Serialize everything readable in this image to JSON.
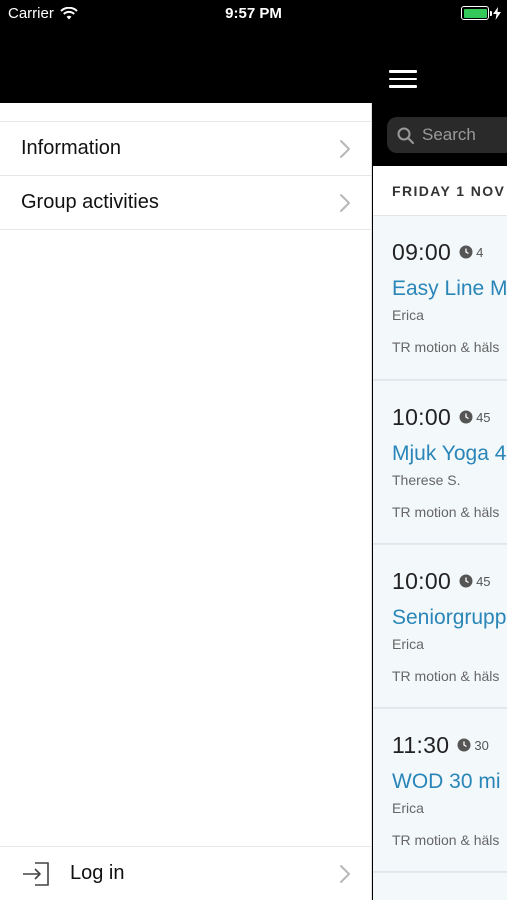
{
  "status_bar": {
    "carrier": "Carrier",
    "time": "9:57 PM",
    "battery_level": 1.0,
    "battery_color": "#34c759"
  },
  "drawer": {
    "items": [
      {
        "label": "Information",
        "icon": "chevron-right-icon"
      },
      {
        "label": "Group activities",
        "icon": "chevron-right-icon"
      }
    ],
    "footer": {
      "label": "Log in",
      "icon": "login-icon"
    }
  },
  "main": {
    "search": {
      "placeholder": "Search"
    },
    "day_header": "FRIDAY 1 NOV",
    "sessions": [
      {
        "time": "09:00",
        "duration": "4",
        "title": "Easy Line M",
        "instructor": "Erica",
        "location": "TR motion & häls"
      },
      {
        "time": "10:00",
        "duration": "45",
        "title": "Mjuk Yoga 4",
        "instructor": "Therese S.",
        "location": "TR motion & häls"
      },
      {
        "time": "10:00",
        "duration": "45",
        "title": "Seniorgrupp",
        "instructor": "Erica",
        "location": "TR motion & häls"
      },
      {
        "time": "11:30",
        "duration": "30",
        "title": "WOD 30 mi",
        "instructor": "Erica",
        "location": "TR motion & häls"
      }
    ],
    "accent_color": "#2a86b8"
  }
}
